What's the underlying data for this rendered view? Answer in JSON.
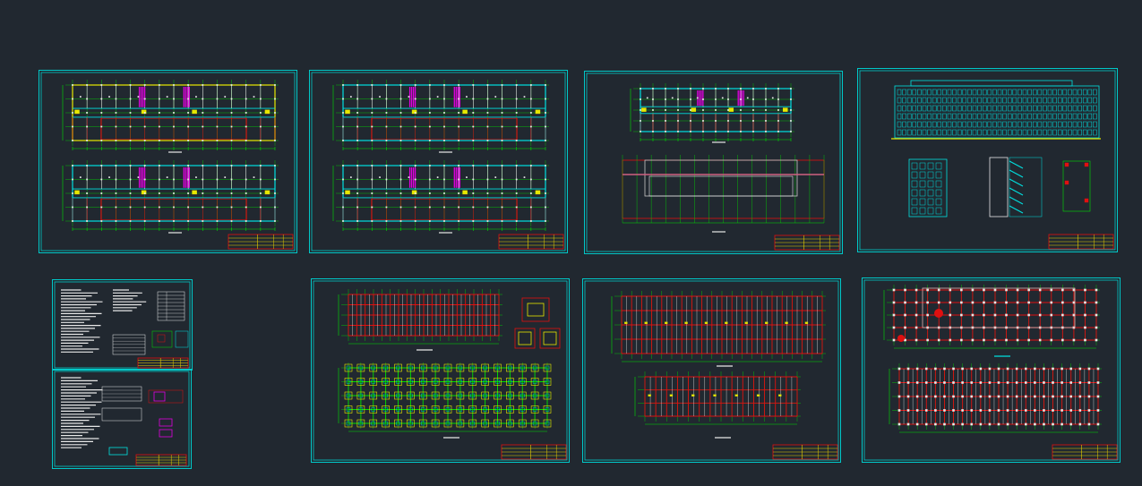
{
  "viewport": {
    "background": "#212830",
    "sheet_count": 9
  },
  "colors": {
    "frame": "#00c8c8",
    "grid": "#00e000",
    "wall": "#e01010",
    "cyan": "#00e0e0",
    "yellow": "#e8e800",
    "magenta": "#e000e0",
    "white": "#e8e8e8",
    "title_block": "#e8d000",
    "title_block_red": "#e01010"
  },
  "sheets": [
    {
      "id": "sheet-floor-plans-1",
      "kind": "floor-plans",
      "variant": "a"
    },
    {
      "id": "sheet-floor-plans-2",
      "kind": "floor-plans",
      "variant": "b"
    },
    {
      "id": "sheet-floor-plan-roof",
      "kind": "plan-roof"
    },
    {
      "id": "sheet-elevations",
      "kind": "elevations-sections"
    },
    {
      "id": "sheet-notes-1",
      "kind": "notes"
    },
    {
      "id": "sheet-notes-2",
      "kind": "notes-details"
    },
    {
      "id": "sheet-foundation",
      "kind": "foundation"
    },
    {
      "id": "sheet-beam-plans",
      "kind": "beam-plans"
    },
    {
      "id": "sheet-column-plans",
      "kind": "column-plans"
    }
  ]
}
